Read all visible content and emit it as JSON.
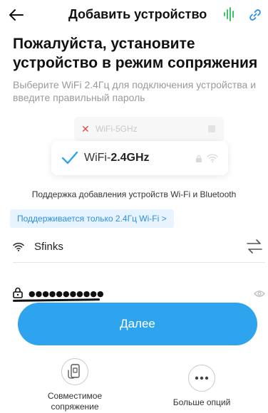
{
  "header": {
    "title": "Добавить устройство"
  },
  "main": {
    "heading": "Пожалуйста, установите устройство в режим сопряжения",
    "subtext": "Выберите WiFi 2.4Гц для подключения устройства и введите правильный пароль"
  },
  "wifi_illustration": {
    "wifi5_label": "WiFi-5GHz",
    "wifi24_prefix": "WiFi-",
    "wifi24_bold": "2.4GHz"
  },
  "support_text": "Поддержка добавления устройств Wi-Fi и Bluetooth",
  "badge": {
    "label": "Поддерживается только 2.4Гц Wi-Fi >"
  },
  "network": {
    "name": "Sfinks"
  },
  "password": {
    "value": "●●●●●●●●●●●"
  },
  "next_button": {
    "label": "Далее"
  },
  "options": {
    "compat_label": "Совместимое сопряжение",
    "more_label": "Больше опций"
  },
  "colors": {
    "accent": "#2ea3ee",
    "voice_green": "#3dc46a",
    "badge_bg": "#e7f4ff",
    "badge_text": "#2b8ee6"
  }
}
